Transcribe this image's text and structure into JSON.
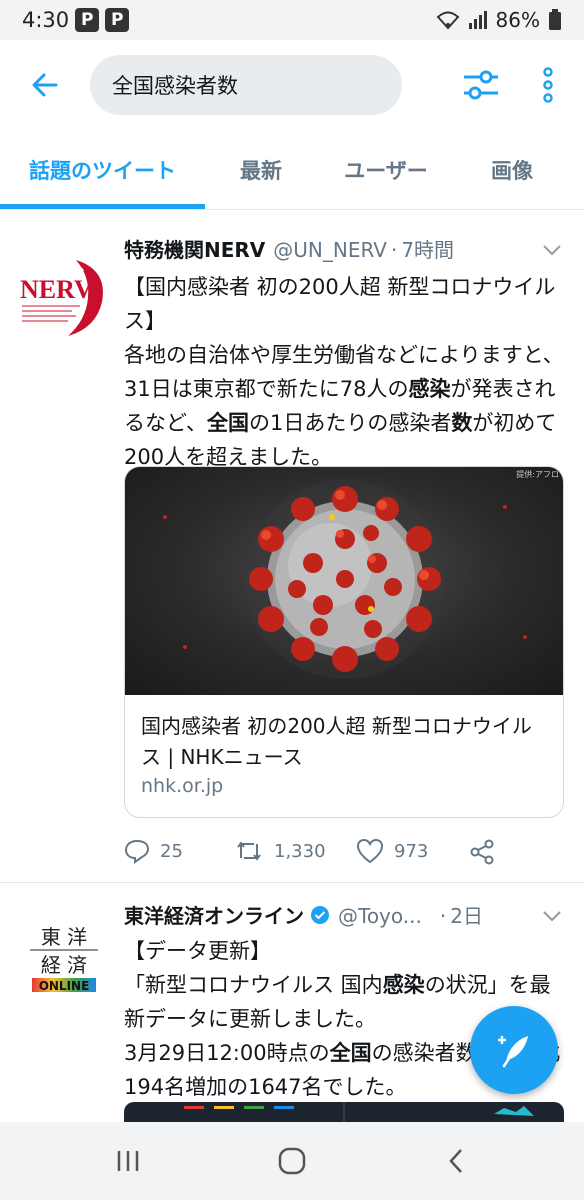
{
  "status_bar": {
    "time": "4:30",
    "app_icon_1": "P",
    "app_icon_2": "P",
    "battery": "86%"
  },
  "search": {
    "query": "全国感染者数"
  },
  "tabs": [
    {
      "label": "話題のツイート",
      "active": true
    },
    {
      "label": "最新"
    },
    {
      "label": "ユーザー"
    },
    {
      "label": "画像"
    }
  ],
  "tweets": [
    {
      "name": "特務機関NERV",
      "handle": "@UN_NERV",
      "sep": "·",
      "time": "7時間",
      "avatar_text": "NERV",
      "text_segments": [
        {
          "t": "【国内感染者 初の200人超 新型コロナウイルス】"
        },
        {
          "t": "各地の自治体や厚生労働省などによりますと、31日は東京都で新たに78人の"
        },
        {
          "t": "感染",
          "b": true
        },
        {
          "t": "が発表されるなど、"
        },
        {
          "t": "全国",
          "b": true
        },
        {
          "t": "の1日あたりの感染者"
        },
        {
          "t": "数",
          "b": true
        },
        {
          "t": "が初めて200人を超えました。"
        }
      ],
      "card": {
        "credit": "提供:アフロ",
        "title": "国内感染者 初の200人超 新型コロナウイルス | NHKニュース",
        "domain": "nhk.or.jp"
      },
      "replies": "25",
      "retweets": "1,330",
      "likes": "973"
    },
    {
      "name": "東洋経済オンライン",
      "handle": "@Toyo...",
      "sep": "·",
      "time": "2日",
      "avatar_line1": "東 洋",
      "avatar_line2": "経 済",
      "avatar_line3": "ONLINE",
      "text_segments": [
        {
          "t": "【データ更新】"
        },
        {
          "t": "「新型コロナウイルス 国内"
        },
        {
          "t": "感染",
          "b": true
        },
        {
          "t": "の状況」を最新データに更新しました。"
        },
        {
          "t": "3月29日12:00時点の"
        },
        {
          "t": "全国",
          "b": true
        },
        {
          "t": "の感染者数は前日比194名増加の1647名でした。"
        }
      ]
    }
  ],
  "colors": {
    "accent": "#1da1f2",
    "text": "#14171a",
    "muted": "#657786",
    "nerv_red": "#c8102e"
  },
  "icons": [
    "back-arrow-icon",
    "filter-icon",
    "more-vertical-icon",
    "chevron-down-icon",
    "reply-icon",
    "retweet-icon",
    "like-icon",
    "share-icon",
    "verified-icon",
    "compose-icon",
    "recents-icon",
    "home-icon",
    "nav-back-icon"
  ]
}
